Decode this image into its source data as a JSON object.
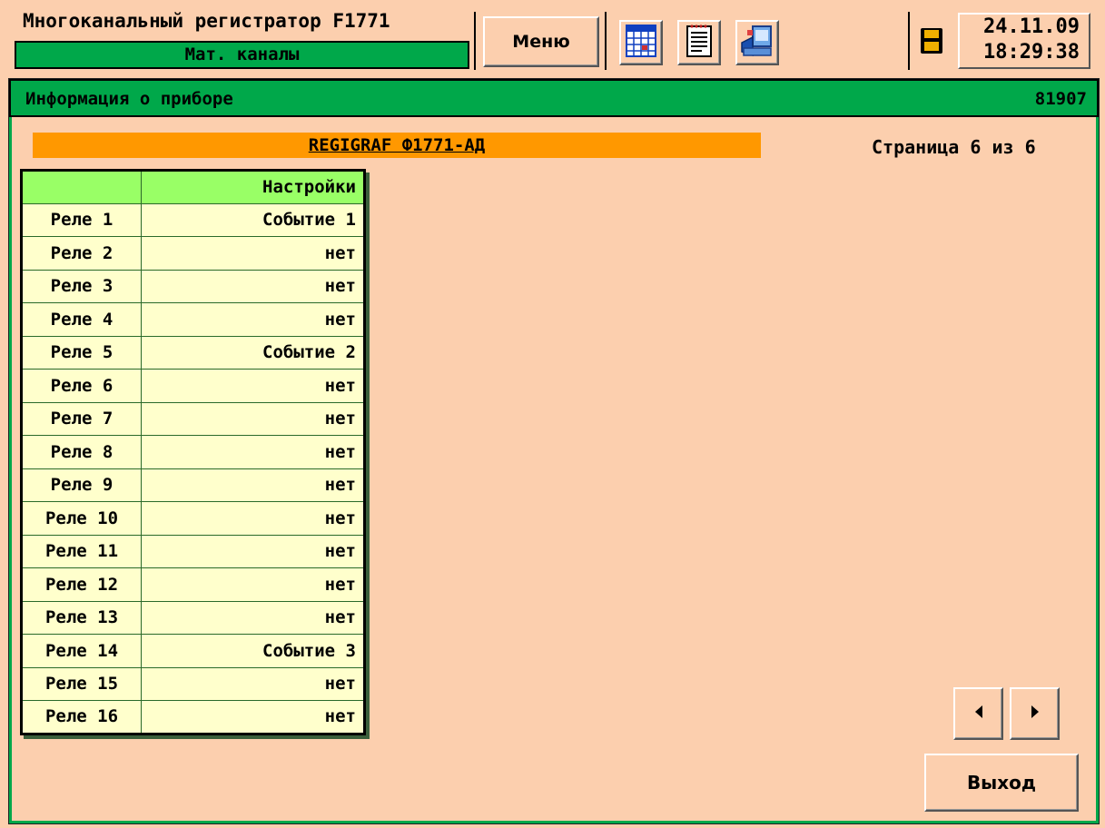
{
  "header": {
    "app_title": "Многоканальный регистратор F1771",
    "subtitle": "Мат. каналы",
    "menu_label": "Меню",
    "date": "24.11.09",
    "time": "18:29:38"
  },
  "icons": {
    "table": "table-icon",
    "document": "document-icon",
    "export": "export-icon",
    "save": "floppy-disk-icon"
  },
  "panel": {
    "title": "Информация о приборе",
    "serial": "81907",
    "model": "REGIGRAF Ф1771-АД",
    "page_indicator": "Страница 6 из 6"
  },
  "table": {
    "col1_header": "",
    "col2_header": "Настройки",
    "rows": [
      {
        "relay": "Реле 1",
        "setting": "Событие 1"
      },
      {
        "relay": "Реле 2",
        "setting": "нет"
      },
      {
        "relay": "Реле 3",
        "setting": "нет"
      },
      {
        "relay": "Реле 4",
        "setting": "нет"
      },
      {
        "relay": "Реле 5",
        "setting": "Событие 2"
      },
      {
        "relay": "Реле 6",
        "setting": "нет"
      },
      {
        "relay": "Реле 7",
        "setting": "нет"
      },
      {
        "relay": "Реле 8",
        "setting": "нет"
      },
      {
        "relay": "Реле 9",
        "setting": "нет"
      },
      {
        "relay": "Реле 10",
        "setting": "нет"
      },
      {
        "relay": "Реле 11",
        "setting": "нет"
      },
      {
        "relay": "Реле 12",
        "setting": "нет"
      },
      {
        "relay": "Реле 13",
        "setting": "нет"
      },
      {
        "relay": "Реле 14",
        "setting": "Событие 3"
      },
      {
        "relay": "Реле 15",
        "setting": "нет"
      },
      {
        "relay": "Реле 16",
        "setting": "нет"
      }
    ]
  },
  "footer": {
    "exit_label": "Выход"
  },
  "colors": {
    "background": "#FCCFAE",
    "accent_green": "#00A84A",
    "model_bar": "#FF9800",
    "table_header": "#99FF66",
    "table_cell": "#FFFFCC"
  }
}
